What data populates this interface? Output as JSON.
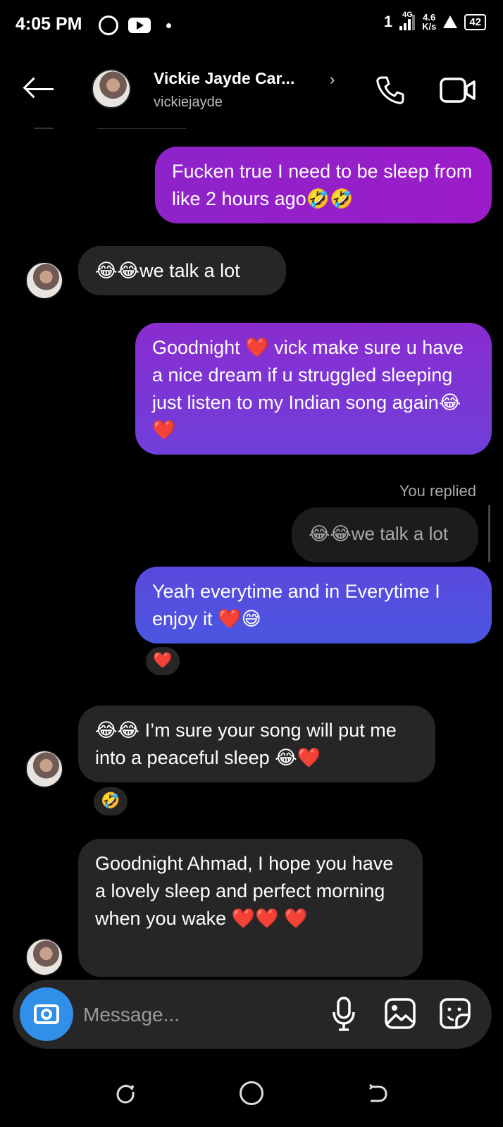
{
  "status_bar": {
    "time": "4:05 PM",
    "network": "4G",
    "speed_value": "4.6",
    "speed_unit": "K/s",
    "battery": "42",
    "icons": [
      "whatsapp-icon",
      "youtube-icon",
      "signal-icon",
      "alert-icon",
      "battery-icon"
    ]
  },
  "header": {
    "contact_name": "Vickie Jayde Car...",
    "username": "vickiejayde",
    "chevron": "›",
    "icons": [
      "back-arrow-icon",
      "phone-icon",
      "video-camera-icon"
    ]
  },
  "messages": [
    {
      "direction": "out",
      "text": "Fucken true I need to be sleep from like 2 hours ago🤣🤣"
    },
    {
      "direction": "in",
      "text": "😂😂we talk a lot"
    },
    {
      "direction": "out",
      "text": "Goodnight ❤️ vick make sure u have a nice dream if u struggled sleeping just listen to my Indian song again😂❤️"
    },
    {
      "direction": "out",
      "replied_label": "You replied",
      "quoted_text": "😂😂we talk a lot",
      "text": "Yeah everytime and in Everytime I enjoy it ❤️😅",
      "reaction": "❤️"
    },
    {
      "direction": "in",
      "text": "😂😂 I’m sure your song will put me into a peaceful sleep 😂❤️",
      "reaction": "🤣"
    },
    {
      "direction": "in",
      "text": "Goodnight Ahmad, I hope you have a lovely sleep and perfect morning when you wake ❤️❤️ ❤️"
    }
  ],
  "composer": {
    "placeholder": "Message...",
    "icons": [
      "camera-icon",
      "microphone-icon",
      "gallery-icon",
      "sticker-icon"
    ]
  },
  "colors": {
    "background": "#000000",
    "incoming_bubble": "#262626",
    "outgoing_purple": "#9b1cc8",
    "outgoing_violet": "#6f3fd9",
    "outgoing_blue": "#4a56e0",
    "camera_button": "#2f8fe9"
  }
}
